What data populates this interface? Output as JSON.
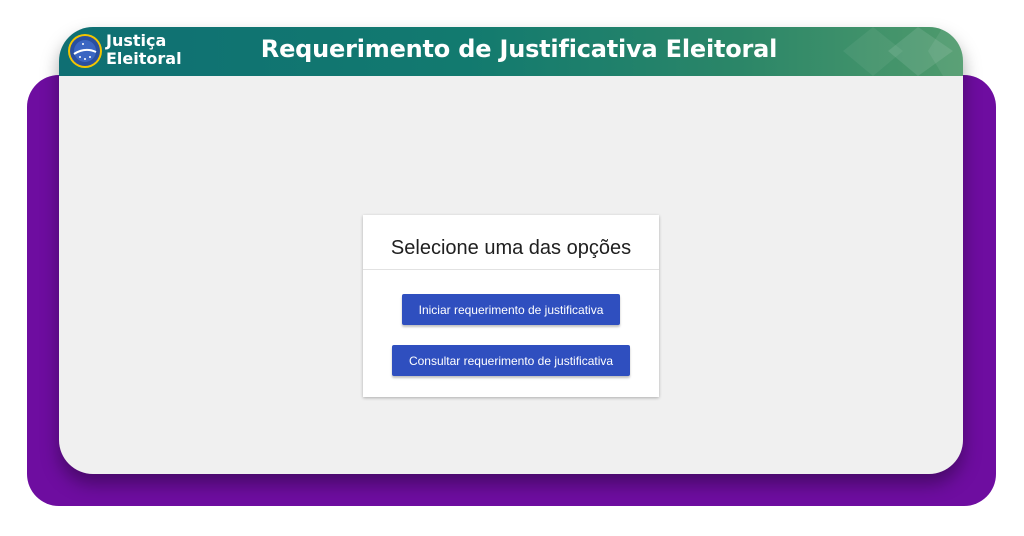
{
  "brand": {
    "line1": "Justiça",
    "line2": "Eleitoral"
  },
  "header": {
    "title": "Requerimento de Justificativa Eleitoral"
  },
  "card": {
    "title": "Selecione uma das opções",
    "buttons": {
      "start": "Iniciar requerimento de justificativa",
      "consult": "Consultar requerimento de justificativa"
    }
  },
  "colors": {
    "backdrop": "#6e0da0",
    "header_start": "#0f6f73",
    "header_end": "#4f9a6c",
    "button": "#2f4fbf",
    "panel": "#f0f0f0"
  },
  "icons": {
    "logo": "brazil-emblem-icon"
  }
}
